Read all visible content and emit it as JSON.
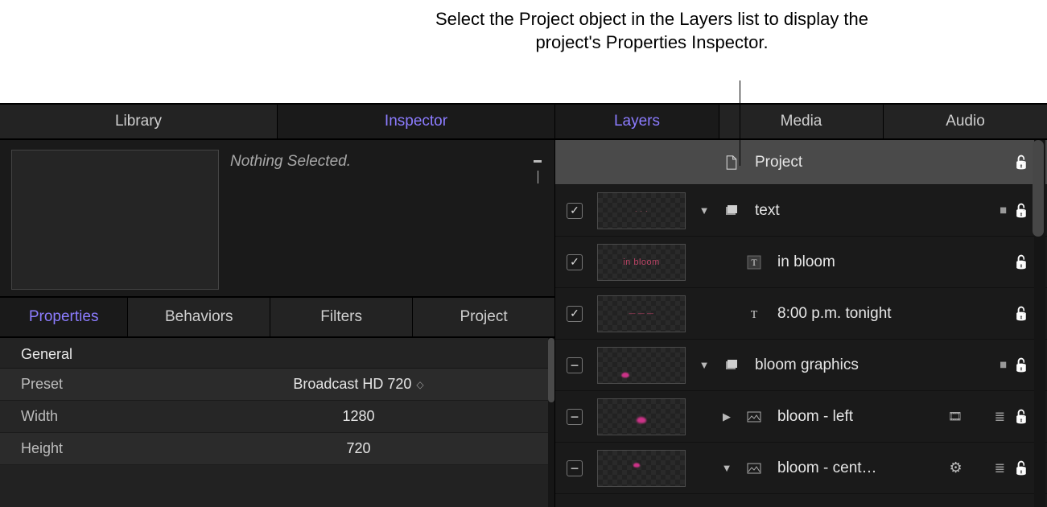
{
  "callout": "Select the Project object in the Layers list to display the project's Properties Inspector.",
  "left_tabs": {
    "library": "Library",
    "inspector": "Inspector"
  },
  "preview": {
    "nothing_selected": "Nothing Selected."
  },
  "sub_tabs": {
    "properties": "Properties",
    "behaviors": "Behaviors",
    "filters": "Filters",
    "project": "Project"
  },
  "properties": {
    "general_header": "General",
    "preset_label": "Preset",
    "preset_value": "Broadcast HD 720",
    "width_label": "Width",
    "width_value": "1280",
    "height_label": "Height",
    "height_value": "720"
  },
  "right_tabs": {
    "layers": "Layers",
    "media": "Media",
    "audio": "Audio"
  },
  "layers": {
    "project": "Project",
    "text_group": "text",
    "in_bloom": "in bloom",
    "tonight": "8:00 p.m. tonight",
    "bloom_graphics": "bloom graphics",
    "bloom_left": "bloom - left",
    "bloom_cent": "bloom - cent…",
    "thumb_in_bloom": "in bloom"
  }
}
